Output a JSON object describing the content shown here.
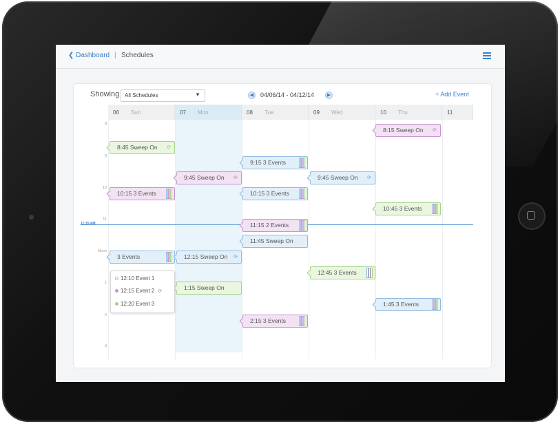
{
  "header": {
    "back_label": "Dashboard",
    "separator": "|",
    "title": "Schedules",
    "menu_icon": "hamburger-menu-icon"
  },
  "toolbar": {
    "showing_label": "Showing",
    "schedule_select": {
      "value": "All Schedules"
    },
    "date_range": "04/06/14 - 04/12/14",
    "add_event_label": "+ Add Event"
  },
  "days": [
    {
      "num": "06",
      "name": "Sun"
    },
    {
      "num": "07",
      "name": "Mon"
    },
    {
      "num": "08",
      "name": "Tue"
    },
    {
      "num": "09",
      "name": "Wed"
    },
    {
      "num": "10",
      "name": "Thu"
    },
    {
      "num": "11",
      "name": ""
    }
  ],
  "hours": [
    "8",
    "9",
    "10",
    "11",
    "Noon",
    "1",
    "2",
    "3"
  ],
  "now_label": "11:15 AM",
  "events": [
    {
      "label": "8:15 Sweep On",
      "color": "pink"
    },
    {
      "label": "8:45 Sweep On",
      "color": "green"
    },
    {
      "label": "9:15 3 Events",
      "color": "blue"
    },
    {
      "label": "9:45 Sweep On",
      "color": "pink"
    },
    {
      "label": "9:45 Sweep On",
      "color": "blue"
    },
    {
      "label": "10:15 3 Events",
      "color": "pink"
    },
    {
      "label": "10:15 3 Events",
      "color": "blue"
    },
    {
      "label": "10:45 3 Events",
      "color": "green"
    },
    {
      "label": "11:15 2 Events",
      "color": "pink"
    },
    {
      "label": "11:45 Sweep On",
      "color": "blue"
    },
    {
      "label": "3 Events",
      "color": "blue"
    },
    {
      "label": "12:15 Sweep On",
      "color": "blue"
    },
    {
      "label": "12:45 3 Events",
      "color": "green"
    },
    {
      "label": "1:15 Sweep On",
      "color": "green"
    },
    {
      "label": "1:45 3 Events",
      "color": "blue"
    },
    {
      "label": "2:15 3 Events",
      "color": "pink"
    }
  ],
  "popover": {
    "items": [
      {
        "label": "12:10 Event 1",
        "color": "blue"
      },
      {
        "label": "12:15 Event 2",
        "color": "pink"
      },
      {
        "label": "12:20 Event 3",
        "color": "green"
      }
    ]
  },
  "colors": {
    "accent": "#3a82c8",
    "green": "#a5d48a",
    "pink": "#c894ce",
    "blue": "#8cbbe2"
  }
}
